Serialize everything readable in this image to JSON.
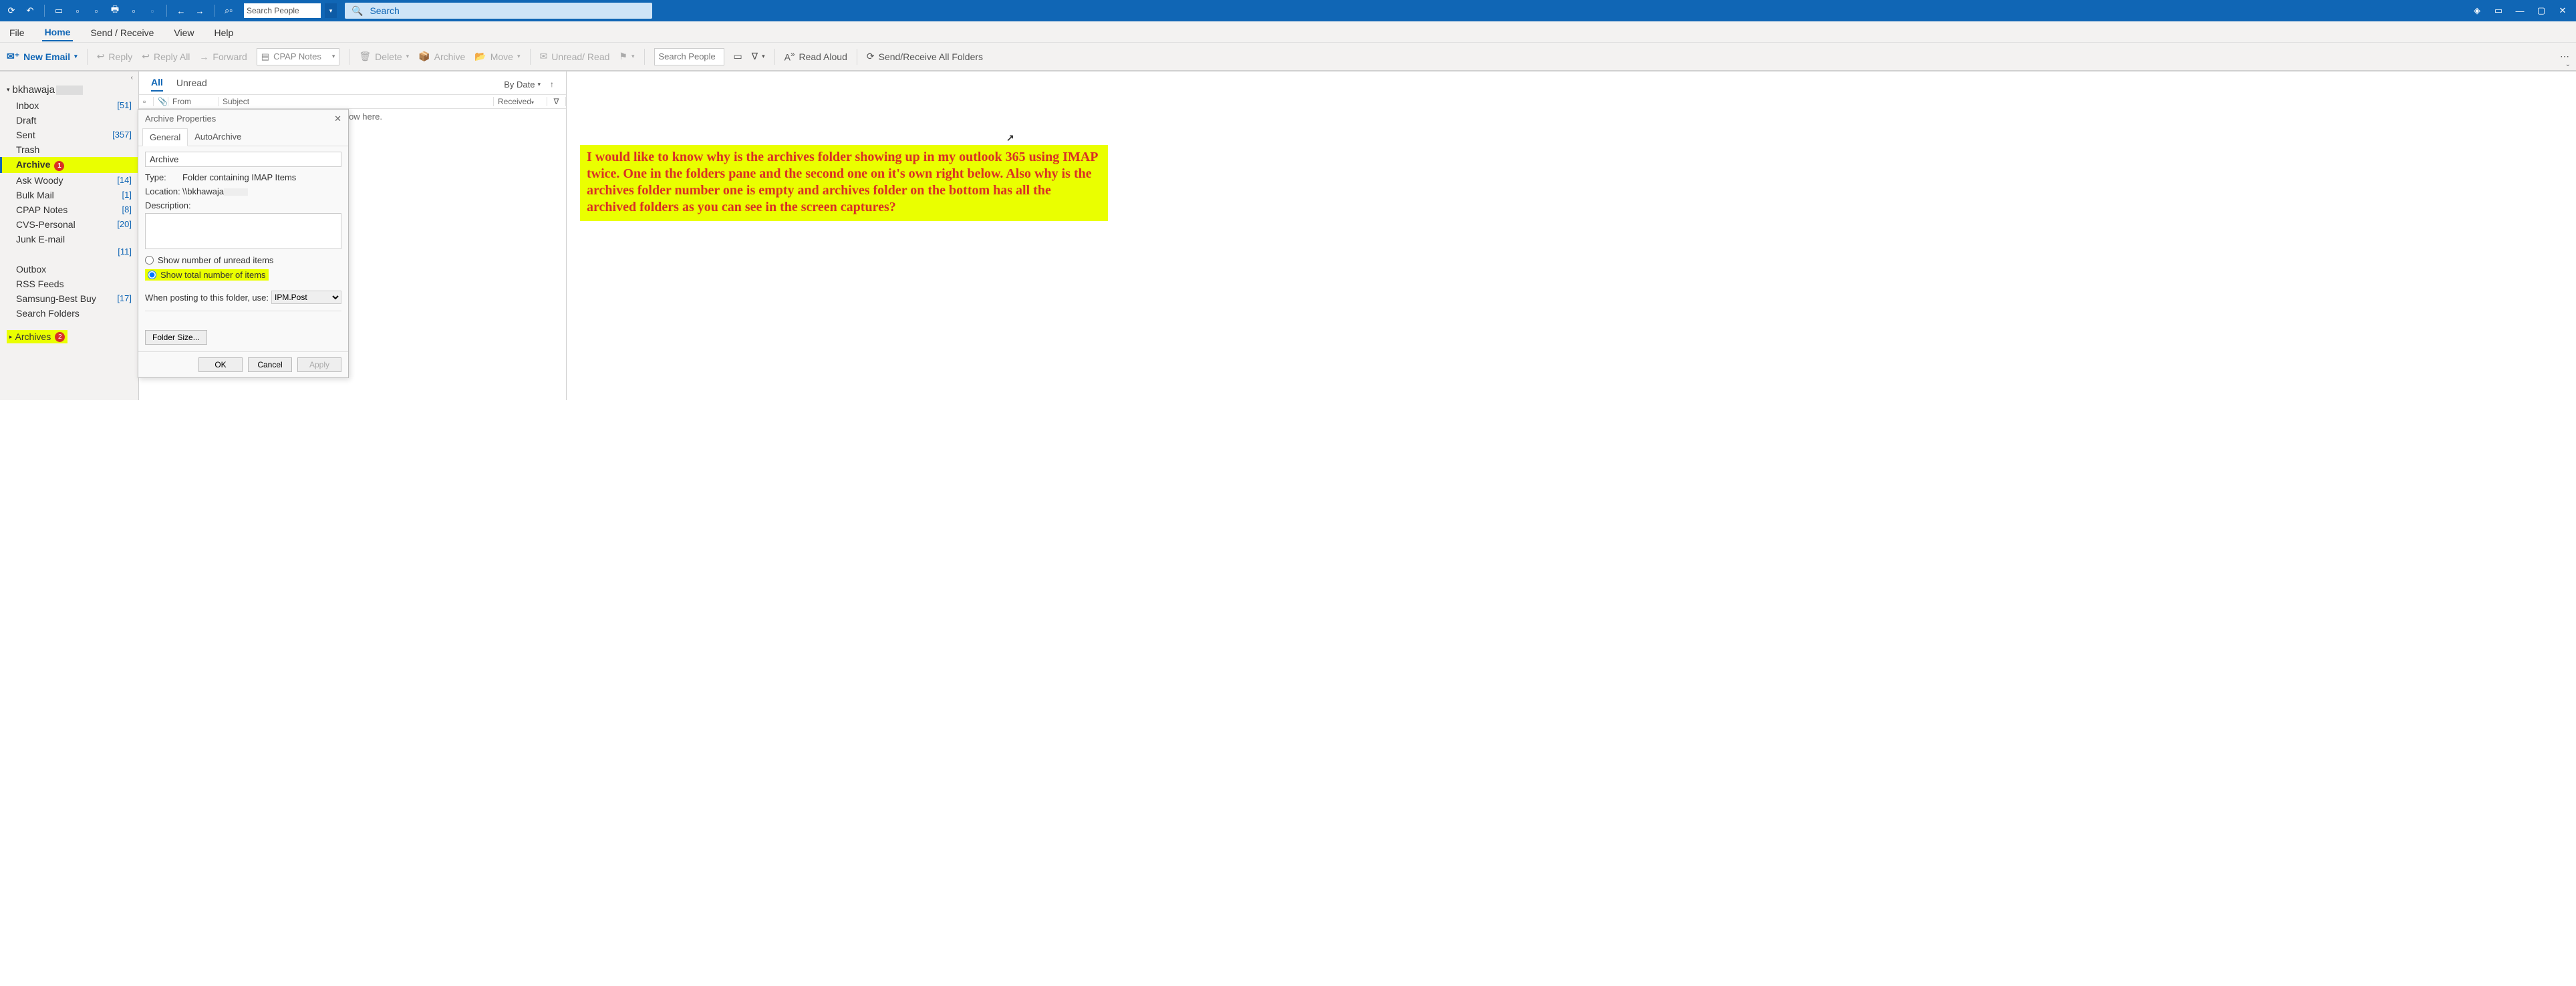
{
  "titlebar": {
    "people_placeholder": "Search People",
    "search_placeholder": "Search"
  },
  "menu": {
    "file": "File",
    "home": "Home",
    "sendreceive": "Send / Receive",
    "view": "View",
    "help": "Help"
  },
  "ribbon": {
    "new_email": "New Email",
    "reply": "Reply",
    "reply_all": "Reply All",
    "forward": "Forward",
    "quickstep": "CPAP Notes",
    "delete": "Delete",
    "archive": "Archive",
    "move": "Move",
    "unread_read": "Unread/ Read",
    "search_people": "Search People",
    "read_aloud": "Read Aloud",
    "send_receive_all": "Send/Receive All Folders"
  },
  "folders": {
    "account": "bkhawaja",
    "items": [
      {
        "name": "Inbox",
        "count": "[51]"
      },
      {
        "name": "Draft",
        "count": ""
      },
      {
        "name": "Sent",
        "count": "[357]"
      },
      {
        "name": "Trash",
        "count": ""
      },
      {
        "name": "Archive",
        "count": "",
        "selected": true,
        "badge": "1"
      },
      {
        "name": "Ask Woody",
        "count": "[14]"
      },
      {
        "name": "Bulk Mail",
        "count": "[1]"
      },
      {
        "name": "CPAP Notes",
        "count": "[8]"
      },
      {
        "name": "CVS-Personal",
        "count": "[20]"
      },
      {
        "name": "Junk E-mail",
        "count": ""
      }
    ],
    "stray_count": "[11]",
    "items2": [
      {
        "name": "Outbox",
        "count": ""
      },
      {
        "name": "RSS Feeds",
        "count": ""
      },
      {
        "name": "Samsung-Best Buy",
        "count": "[17]"
      },
      {
        "name": "Search Folders",
        "count": ""
      }
    ],
    "archives": {
      "name": "Archives",
      "badge": "2"
    }
  },
  "msglist": {
    "tab_all": "All",
    "tab_unread": "Unread",
    "sort": "By Date",
    "col_from": "From",
    "col_subject": "Subject",
    "col_received": "Received",
    "empty": "g to show here."
  },
  "dialog": {
    "title": "Archive Properties",
    "tab_general": "General",
    "tab_autoarchive": "AutoArchive",
    "folder_name": "Archive",
    "type_label": "Type:",
    "type_value": "Folder containing IMAP Items",
    "loc_label": "Location:",
    "loc_value": "\\\\bkhawaja",
    "desc_label": "Description:",
    "radio_unread": "Show number of unread items",
    "radio_total": "Show total number of items",
    "posting_label": "When posting to this folder, use:",
    "posting_value": "IPM.Post",
    "folder_size": "Folder Size...",
    "ok": "OK",
    "cancel": "Cancel",
    "apply": "Apply"
  },
  "question": "I would like to know why is the archives folder showing up in my outlook 365 using IMAP twice. One in the folders pane and the second one on it's own right below. Also why is the archives folder number one is empty and archives folder on the bottom has all the archived folders as you can see in the screen captures?"
}
